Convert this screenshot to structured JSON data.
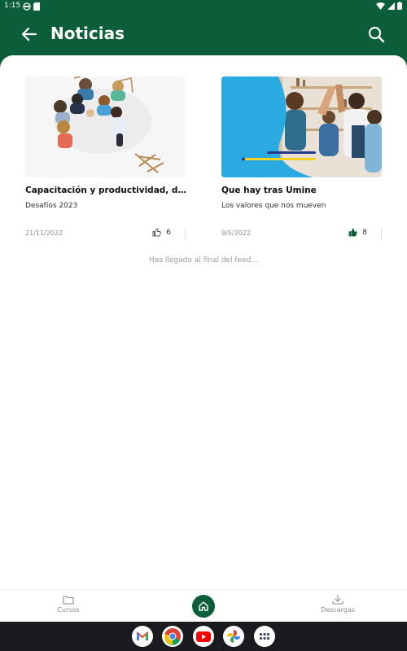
{
  "status_bar": {
    "time": "1:15"
  },
  "app_bar": {
    "title": "Noticias"
  },
  "cards": [
    {
      "title": "Capacitación y productividad, desafí...",
      "subtitle": "Desafíos 2023",
      "date": "21/11/2022",
      "likes": "6",
      "liked": false
    },
    {
      "title": "Que hay tras Umine",
      "subtitle": "Los valores que nos mueven",
      "date": "9/5/2022",
      "likes": "8",
      "liked": true
    }
  ],
  "feed_end_text": "Has llegado al final del feed...",
  "bottom_nav": {
    "left_label": "Cursos",
    "right_label": "Descargas"
  },
  "colors": {
    "primary": "#0c5e3a",
    "blue": "#29abe2",
    "accent_yellow": "#f5d21f",
    "accent_navy": "#253a8c"
  },
  "dock_apps": [
    "gmail-icon",
    "chrome-icon",
    "youtube-icon",
    "photos-icon",
    "app-drawer-icon"
  ]
}
